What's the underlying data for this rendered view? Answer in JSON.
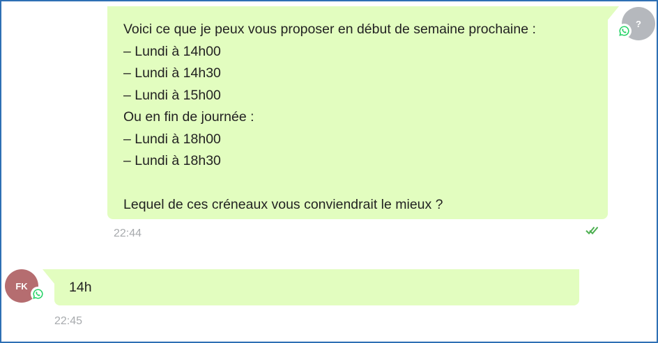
{
  "conversation": {
    "outgoing": {
      "avatar_initial": "?",
      "lines": [
        "Voici ce que je peux vous proposer en début de semaine prochaine :",
        "– Lundi à 14h00",
        "– Lundi à 14h30",
        "– Lundi à 15h00",
        "Ou en fin de journée :",
        "– Lundi à 18h00",
        "– Lundi à 18h30",
        "",
        "Lequel de ces créneaux vous conviendrait le mieux ?"
      ],
      "time": "22:44",
      "status_icon": "double-check-icon"
    },
    "incoming": {
      "avatar_initials": "FK",
      "text": "14h",
      "time": "22:45"
    },
    "channel_icon": "whatsapp-icon"
  },
  "colors": {
    "bubble": "#e2fdbf",
    "frame_border": "#2e6fb4",
    "avatar_me": "#b5b8bd",
    "avatar_fk": "#b56d70",
    "whatsapp": "#25d366",
    "read_ticks": "#4caf50",
    "timestamp": "#a7aaad"
  }
}
